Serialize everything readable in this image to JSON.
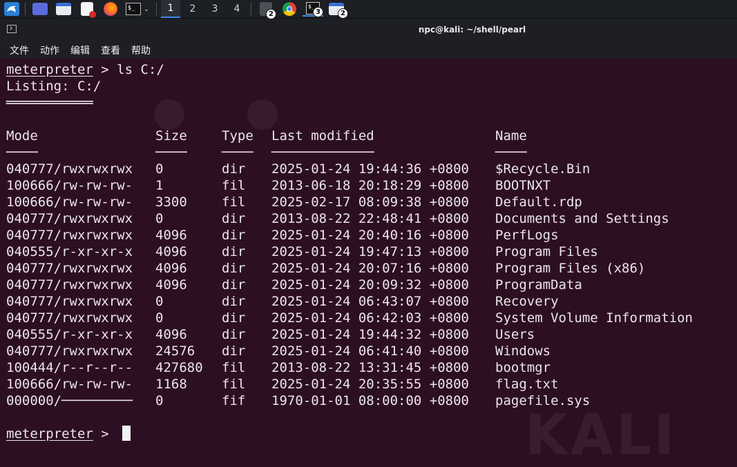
{
  "taskbar": {
    "workspaces": [
      "1",
      "2",
      "3",
      "4"
    ],
    "active_workspace": "1",
    "badges": {
      "files": "2",
      "terminal": "3",
      "explorer": "2"
    }
  },
  "window": {
    "title": "npc@kali: ~/shell/pearl"
  },
  "menu": [
    "文件",
    "动作",
    "编辑",
    "查看",
    "帮助"
  ],
  "terminal": {
    "command_prompt": "meterpreter",
    "command": " > ls C:/",
    "listing_header": "Listing: C:/",
    "listing_underline": "═══════════",
    "columns": [
      "Mode",
      "Size",
      "Type",
      "Last modified",
      "Name"
    ],
    "column_underlines": [
      "────",
      "────",
      "────",
      "─────────────",
      "────"
    ],
    "rows": [
      {
        "mode": "040777/rwxrwxrwx",
        "size": "0",
        "type": "dir",
        "modified": "2025-01-24 19:44:36 +0800",
        "name": "$Recycle.Bin"
      },
      {
        "mode": "100666/rw-rw-rw-",
        "size": "1",
        "type": "fil",
        "modified": "2013-06-18 20:18:29 +0800",
        "name": "BOOTNXT"
      },
      {
        "mode": "100666/rw-rw-rw-",
        "size": "3300",
        "type": "fil",
        "modified": "2025-02-17 08:09:38 +0800",
        "name": "Default.rdp"
      },
      {
        "mode": "040777/rwxrwxrwx",
        "size": "0",
        "type": "dir",
        "modified": "2013-08-22 22:48:41 +0800",
        "name": "Documents and Settings"
      },
      {
        "mode": "040777/rwxrwxrwx",
        "size": "4096",
        "type": "dir",
        "modified": "2025-01-24 20:40:16 +0800",
        "name": "PerfLogs"
      },
      {
        "mode": "040555/r-xr-xr-x",
        "size": "4096",
        "type": "dir",
        "modified": "2025-01-24 19:47:13 +0800",
        "name": "Program Files"
      },
      {
        "mode": "040777/rwxrwxrwx",
        "size": "4096",
        "type": "dir",
        "modified": "2025-01-24 20:07:16 +0800",
        "name": "Program Files (x86)"
      },
      {
        "mode": "040777/rwxrwxrwx",
        "size": "4096",
        "type": "dir",
        "modified": "2025-01-24 20:09:32 +0800",
        "name": "ProgramData"
      },
      {
        "mode": "040777/rwxrwxrwx",
        "size": "0",
        "type": "dir",
        "modified": "2025-01-24 06:43:07 +0800",
        "name": "Recovery"
      },
      {
        "mode": "040777/rwxrwxrwx",
        "size": "0",
        "type": "dir",
        "modified": "2025-01-24 06:42:03 +0800",
        "name": "System Volume Information"
      },
      {
        "mode": "040555/r-xr-xr-x",
        "size": "4096",
        "type": "dir",
        "modified": "2025-01-24 19:44:32 +0800",
        "name": "Users"
      },
      {
        "mode": "040777/rwxrwxrwx",
        "size": "24576",
        "type": "dir",
        "modified": "2025-01-24 06:41:40 +0800",
        "name": "Windows"
      },
      {
        "mode": "100444/r--r--r--",
        "size": "427680",
        "type": "fil",
        "modified": "2013-08-22 13:31:45 +0800",
        "name": "bootmgr"
      },
      {
        "mode": "100666/rw-rw-rw-",
        "size": "1168",
        "type": "fil",
        "modified": "2025-01-24 20:35:55 +0800",
        "name": "flag.txt"
      },
      {
        "mode": "000000/─────────",
        "size": "0",
        "type": "fif",
        "modified": "1970-01-01 08:00:00 +0800",
        "name": "pagefile.sys"
      }
    ],
    "final_prompt": "meterpreter",
    "final_prompt_suffix": " > "
  },
  "watermark": "KALI",
  "colors": {
    "terminal_bg": "#2d0f23",
    "text": "#eae6ea",
    "accent": "#3b8ee8"
  }
}
